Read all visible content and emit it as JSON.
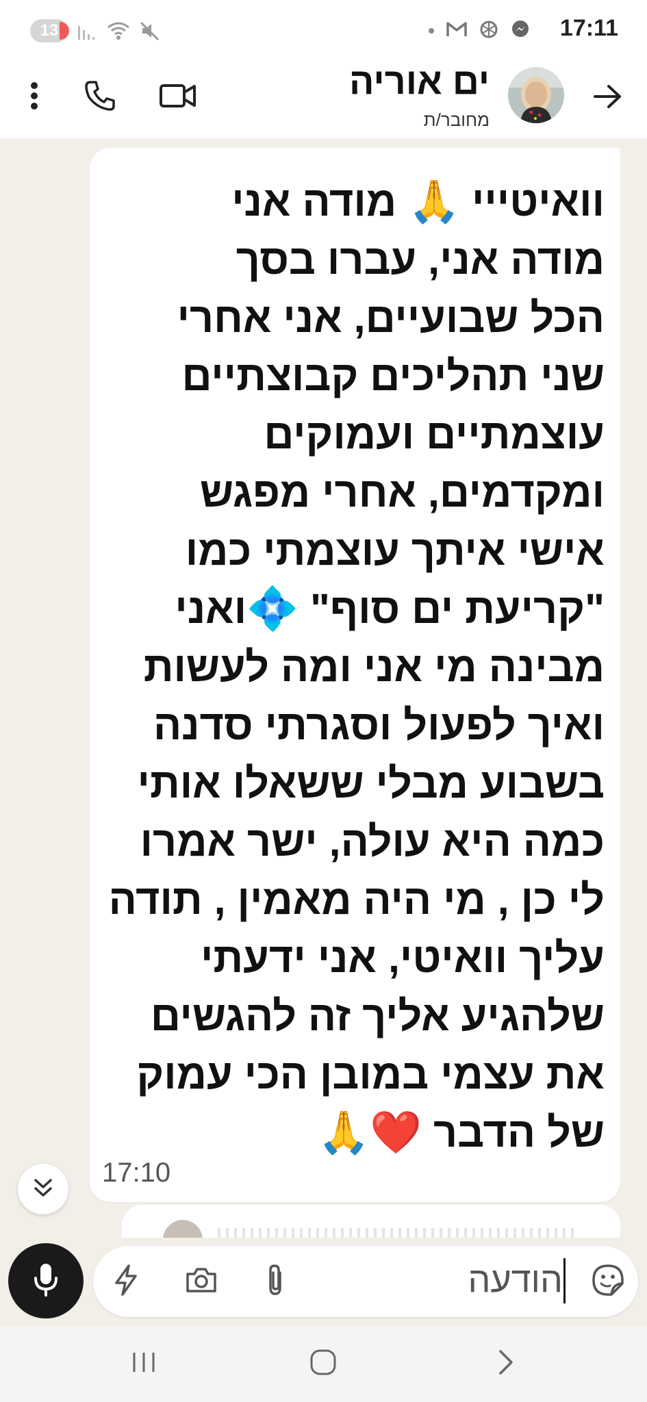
{
  "status_bar": {
    "notification_count": "13",
    "time": "17:11",
    "icons": [
      "signal-icon",
      "wifi-icon",
      "mute-icon",
      "dot-icon",
      "gmail-icon",
      "chatgpt-icon",
      "messenger-icon"
    ]
  },
  "header": {
    "contact_name": "ים אוריה",
    "contact_status": "מחובר/ת",
    "icons": [
      "back-arrow-icon",
      "avatar",
      "video-call-icon",
      "phone-icon",
      "more-options-icon"
    ]
  },
  "message": {
    "text": "וואיטייי 🙏 מודה אני\nמודה אני, עברו בסך\nהכל שבועיים, אני אחרי\nשני תהליכים קבוצתיים\nעוצמתיים ועמוקים\nומקדמים, אחרי מפגש\nאישי איתך עוצמתי כמו\n\"קריעת ים סוף\" 💠ואני\nמבינה מי אני ומה לעשות\nואיך לפעול וסגרתי סדנה\nבשבוע מבלי ששאלו אותי\nכמה היא עולה, ישר אמרו\nלי כן , מי היה מאמין , תודה\nעליך וואיטי, אני ידעתי\nשלהגיע אליך זה להגשים\nאת עצמי במובן הכי עמוק\nשל הדבר ❤️🙏",
    "time": "17:10"
  },
  "compose": {
    "placeholder": "הודעה",
    "icons": [
      "mic-icon",
      "bolt-icon",
      "camera-icon",
      "attach-icon",
      "emoji-sticker-icon"
    ]
  },
  "nav_bar": {
    "icons": [
      "recent-apps-icon",
      "home-icon",
      "back-icon"
    ]
  },
  "colors": {
    "chat_background": "#f2efe9",
    "bubble": "#ffffff",
    "mic_button": "#1a1a1a"
  }
}
